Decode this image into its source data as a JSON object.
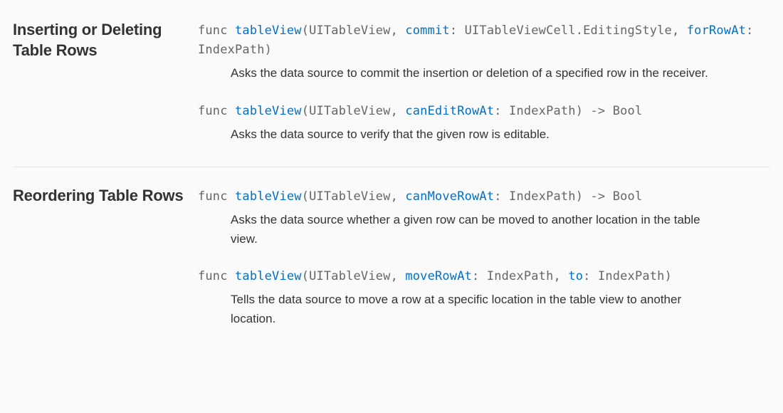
{
  "sections": [
    {
      "title": "Inserting or Deleting Table Rows",
      "items": [
        {
          "sig_html": "<span class='kw'>func</span> <span class='fn'>tableView</span>(<span class='type'>UITableView</span>, <span class='lbl'>commit</span>: <span class='type'>UITableViewCell.EditingStyle</span>, <span class='lbl'>forRowAt</span>: <span class='type'>IndexPath</span>)",
          "desc": "Asks the data source to commit the insertion or deletion of a specified row in the receiver."
        },
        {
          "sig_html": "<span class='kw'>func</span> <span class='fn'>tableView</span>(<span class='type'>UITableView</span>, <span class='lbl'>canEditRowAt</span>: <span class='type'>IndexPath</span>) -> <span class='type'>Bool</span>",
          "desc": "Asks the data source to verify that the given row is editable."
        }
      ]
    },
    {
      "title": "Reordering Table Rows",
      "items": [
        {
          "sig_html": "<span class='kw'>func</span> <span class='fn'>tableView</span>(<span class='type'>UITableView</span>, <span class='lbl'>canMoveRowAt</span>: <span class='type'>IndexPath</span>) -> <span class='type'>Bool</span>",
          "desc": "Asks the data source whether a given row can be moved to another location in the table view."
        },
        {
          "sig_html": "<span class='kw'>func</span> <span class='fn'>tableView</span>(<span class='type'>UITableView</span>, <span class='lbl'>moveRowAt</span>: <span class='type'>IndexPath</span>, <span class='lbl'>to</span>: <span class='type'>IndexPath</span>)",
          "desc": "Tells the data source to move a row at a specific location in the table view to another location."
        }
      ]
    }
  ]
}
